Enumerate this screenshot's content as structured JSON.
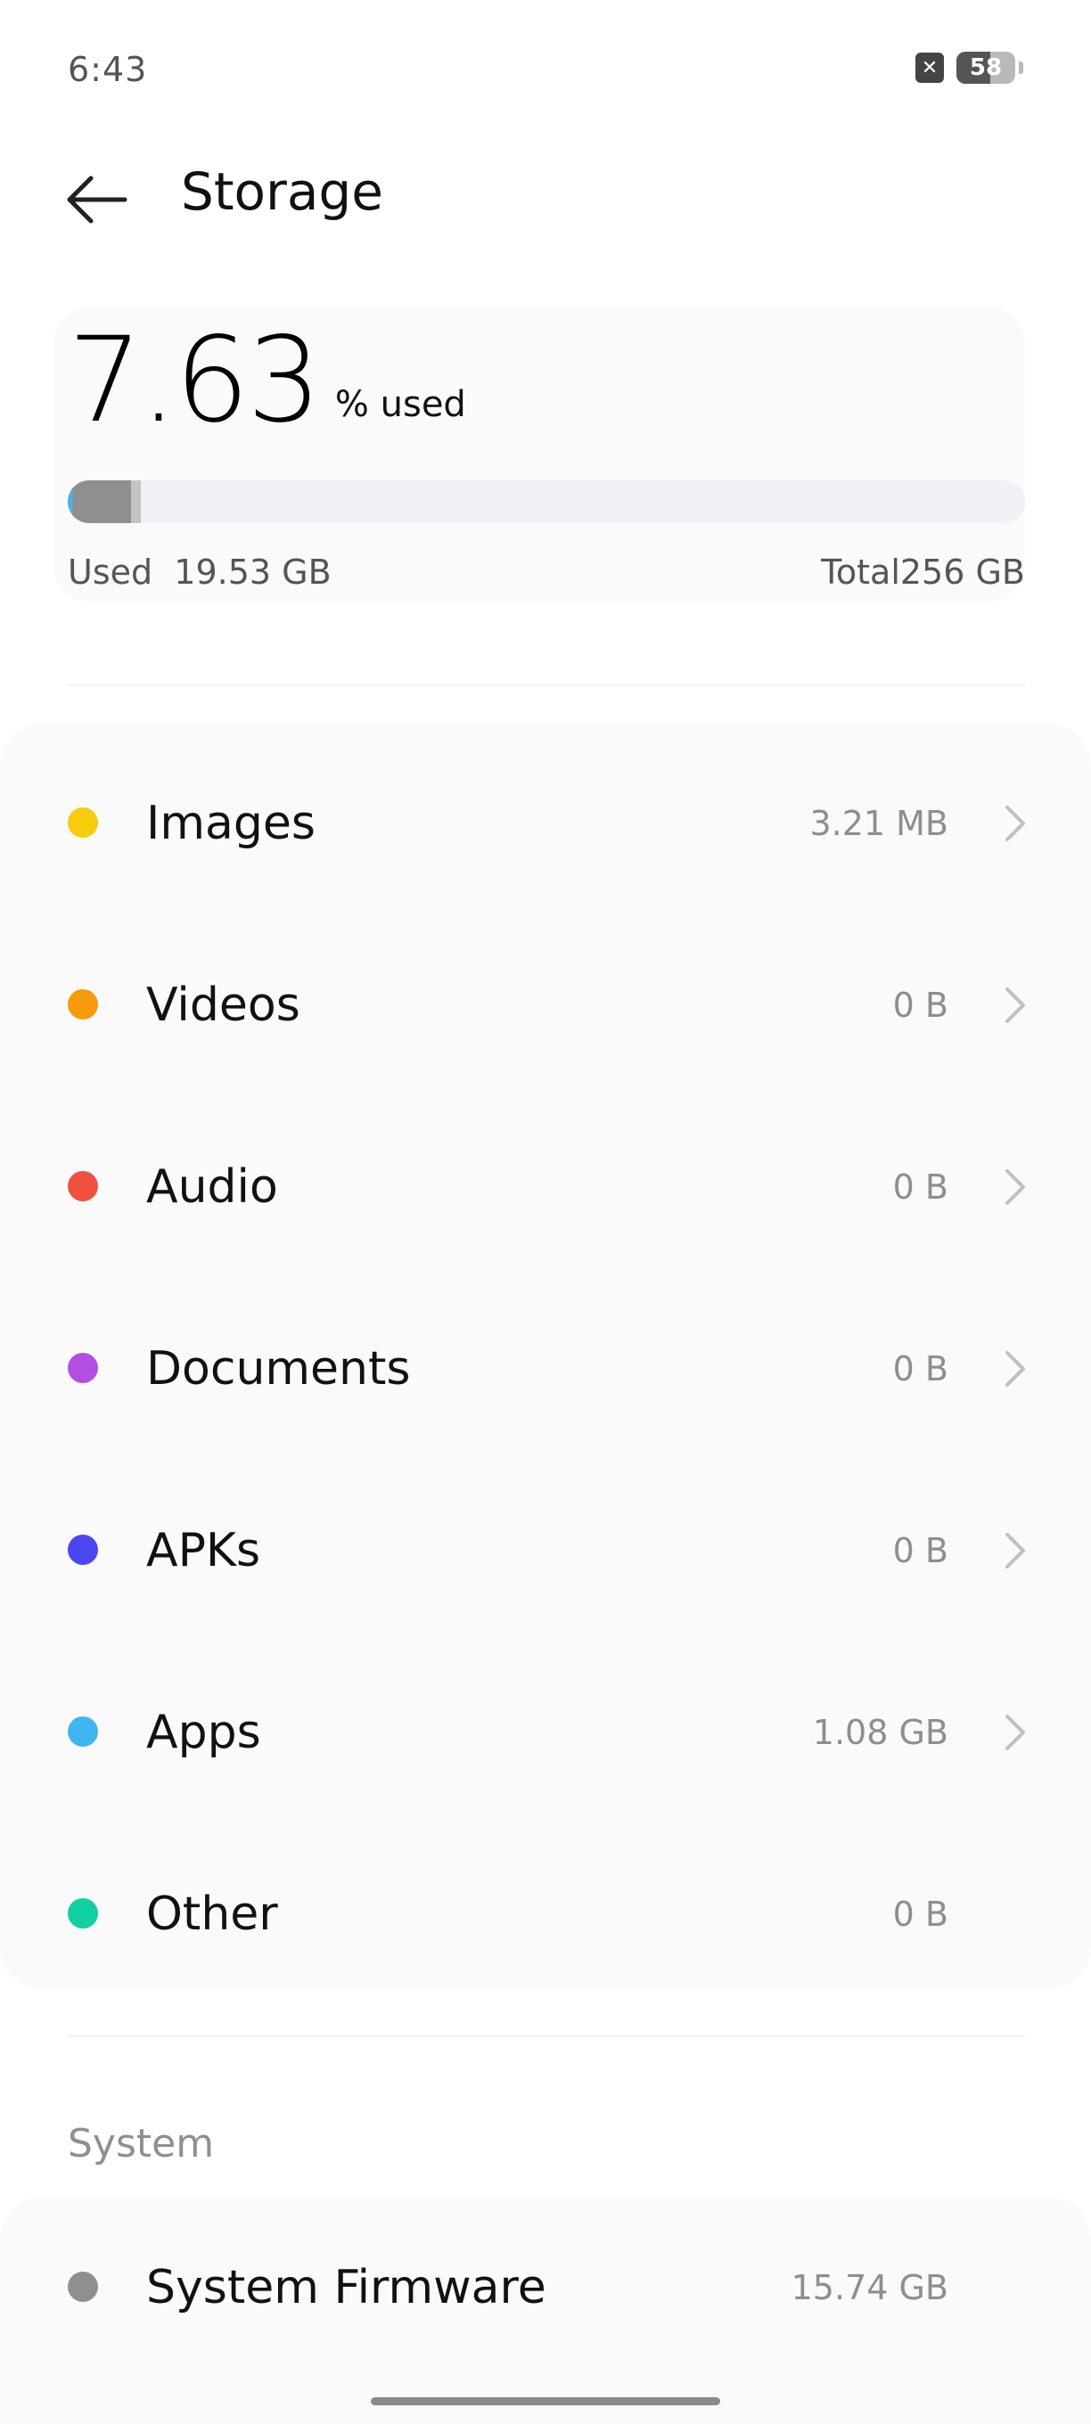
{
  "status_bar": {
    "time": "6:43",
    "battery_level": "58",
    "sim_icon": "no-sim-icon",
    "battery_icon": "battery-icon"
  },
  "header": {
    "back_icon": "arrow-left-icon",
    "title": "Storage"
  },
  "summary": {
    "percent": "7.63",
    "percent_suffix": "% used",
    "used_label": "Used",
    "used_value": "19.53 GB",
    "total_label": "Total",
    "total_value": "256 GB",
    "bar": [
      {
        "name": "apps",
        "fraction": 0.0042,
        "color": "#3fb6f2"
      },
      {
        "name": "system",
        "fraction": 0.0615,
        "color": "#8f8f8f"
      },
      {
        "name": "other",
        "fraction": 0.0106,
        "color": "#c4c4c4"
      }
    ]
  },
  "categories": [
    {
      "label": "Images",
      "size": "3.21 MB",
      "color": "#f7cc0c",
      "chevron": true
    },
    {
      "label": "Videos",
      "size": "0 B",
      "color": "#f79a0c",
      "chevron": true
    },
    {
      "label": "Audio",
      "size": "0 B",
      "color": "#f0503f",
      "chevron": true
    },
    {
      "label": "Documents",
      "size": "0 B",
      "color": "#b24ee0",
      "chevron": true
    },
    {
      "label": "APKs",
      "size": "0 B",
      "color": "#4a46f0",
      "chevron": true
    },
    {
      "label": "Apps",
      "size": "1.08 GB",
      "color": "#3fb6f2",
      "chevron": true
    },
    {
      "label": "Other",
      "size": "0 B",
      "color": "#10cfa0",
      "chevron": false
    }
  ],
  "system": {
    "section_title": "System",
    "items": [
      {
        "label": "System Firmware",
        "size": "15.74 GB",
        "color": "#8f8f8f"
      }
    ]
  }
}
